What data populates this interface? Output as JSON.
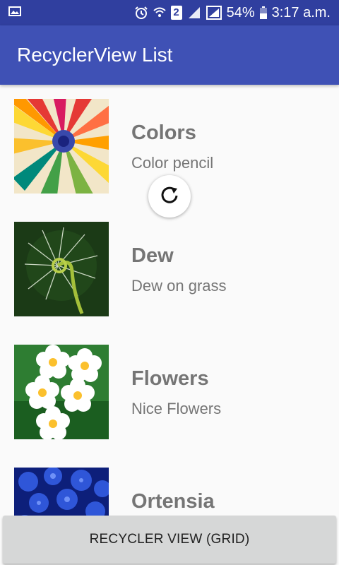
{
  "status_bar": {
    "battery_percent": "54%",
    "time": "3:17 a.m.",
    "sim_badge": "2",
    "icons": [
      "image-icon",
      "alarm-icon",
      "wifi-icon",
      "sim-icon",
      "signal-icon",
      "signal-icon",
      "battery-icon"
    ]
  },
  "app_bar": {
    "title": "RecyclerView List"
  },
  "items": [
    {
      "title": "Colors",
      "subtitle": "Color pencil"
    },
    {
      "title": "Dew",
      "subtitle": "Dew on grass"
    },
    {
      "title": "Flowers",
      "subtitle": "Nice Flowers"
    },
    {
      "title": "Ortensia",
      "subtitle": ""
    }
  ],
  "refresh_indicator": {
    "icon": "refresh-icon"
  },
  "bottom_button": {
    "label": "RECYCLER VIEW (GRID)"
  },
  "colors": {
    "status_bar": "#303f9f",
    "app_bar": "#3f51b5",
    "text_gray": "#757575",
    "button_bg": "#d6d7d7"
  }
}
